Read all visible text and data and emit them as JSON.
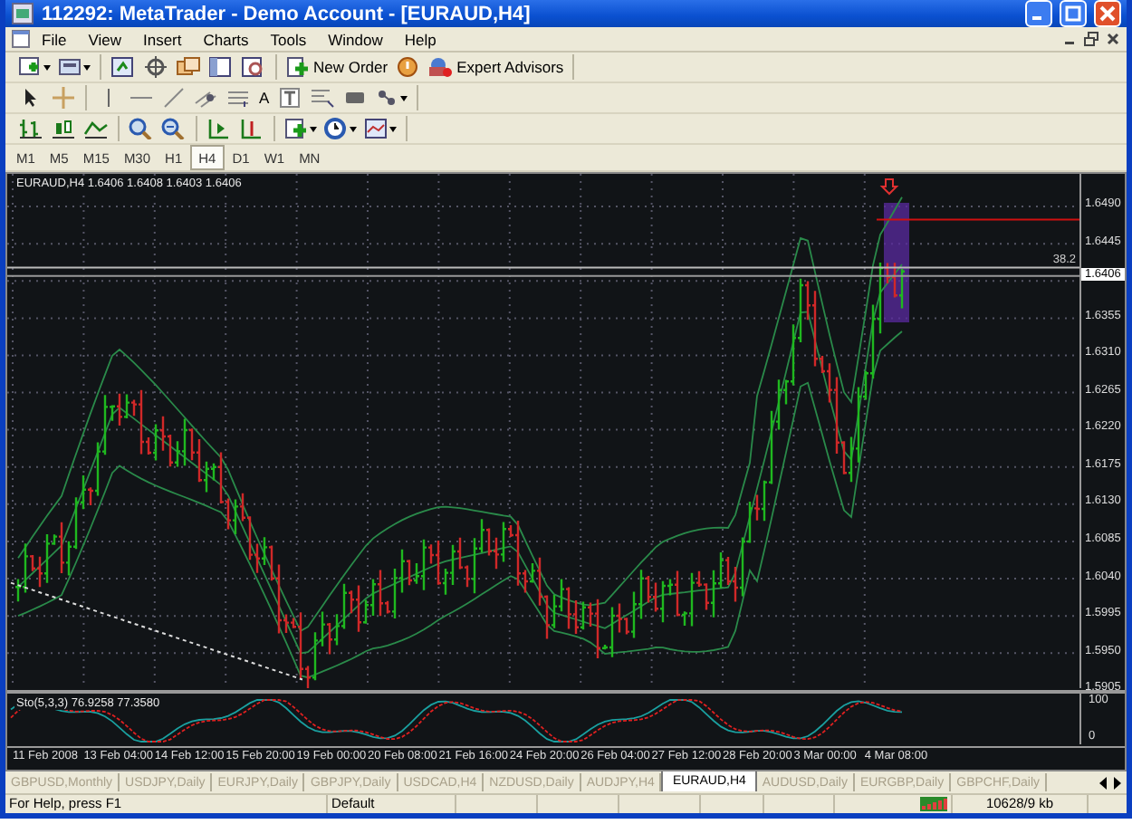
{
  "window": {
    "title": "112292: MetaTrader - Demo Account - [EURAUD,H4]"
  },
  "menu": [
    "File",
    "View",
    "Insert",
    "Charts",
    "Tools",
    "Window",
    "Help"
  ],
  "toolbar": {
    "new_order": "New Order",
    "expert_advisors": "Expert Advisors",
    "text_tool": "A"
  },
  "timeframes": [
    {
      "label": "M1",
      "selected": false
    },
    {
      "label": "M5",
      "selected": false
    },
    {
      "label": "M15",
      "selected": false
    },
    {
      "label": "M30",
      "selected": false
    },
    {
      "label": "H1",
      "selected": false
    },
    {
      "label": "H4",
      "selected": true
    },
    {
      "label": "D1",
      "selected": false
    },
    {
      "label": "W1",
      "selected": false
    },
    {
      "label": "MN",
      "selected": false
    }
  ],
  "chart": {
    "header": "EURAUD,H4  1.6406 1.6408 1.6403 1.6406",
    "price_labels": [
      "1.6490",
      "1.6445",
      "1.6355",
      "1.6310",
      "1.6265",
      "1.6220",
      "1.6175",
      "1.6130",
      "1.6085",
      "1.6040",
      "1.5995",
      "1.5950",
      "1.5905"
    ],
    "current_price": "1.6406",
    "fibo_label": "38.2",
    "indicator_header": "Sto(5,3,3) 76.9258 77.3580",
    "indicator_labels": [
      "100",
      "0"
    ],
    "time_labels": [
      "11 Feb 2008",
      "13 Feb 04:00",
      "14 Feb 12:00",
      "15 Feb 20:00",
      "19 Feb 00:00",
      "20 Feb 08:00",
      "21 Feb 16:00",
      "24 Feb 20:00",
      "26 Feb 04:00",
      "27 Feb 12:00",
      "28 Feb 20:00",
      "3 Mar 00:00",
      "4 Mar 08:00"
    ]
  },
  "tabs": [
    {
      "label": "GBPUSD,Monthly",
      "selected": false
    },
    {
      "label": "USDJPY,Daily",
      "selected": false
    },
    {
      "label": "EURJPY,Daily",
      "selected": false
    },
    {
      "label": "GBPJPY,Daily",
      "selected": false
    },
    {
      "label": "USDCAD,H4",
      "selected": false
    },
    {
      "label": "NZDUSD,Daily",
      "selected": false
    },
    {
      "label": "AUDJPY,H4",
      "selected": false
    },
    {
      "label": "EURAUD,H4",
      "selected": true
    },
    {
      "label": "AUDUSD,Daily",
      "selected": false
    },
    {
      "label": "EURGBP,Daily",
      "selected": false
    },
    {
      "label": "GBPCHF,Daily",
      "selected": false
    }
  ],
  "status_bar": {
    "help": "For Help, press F1",
    "profile": "Default",
    "traffic": "10628/9 kb"
  }
}
